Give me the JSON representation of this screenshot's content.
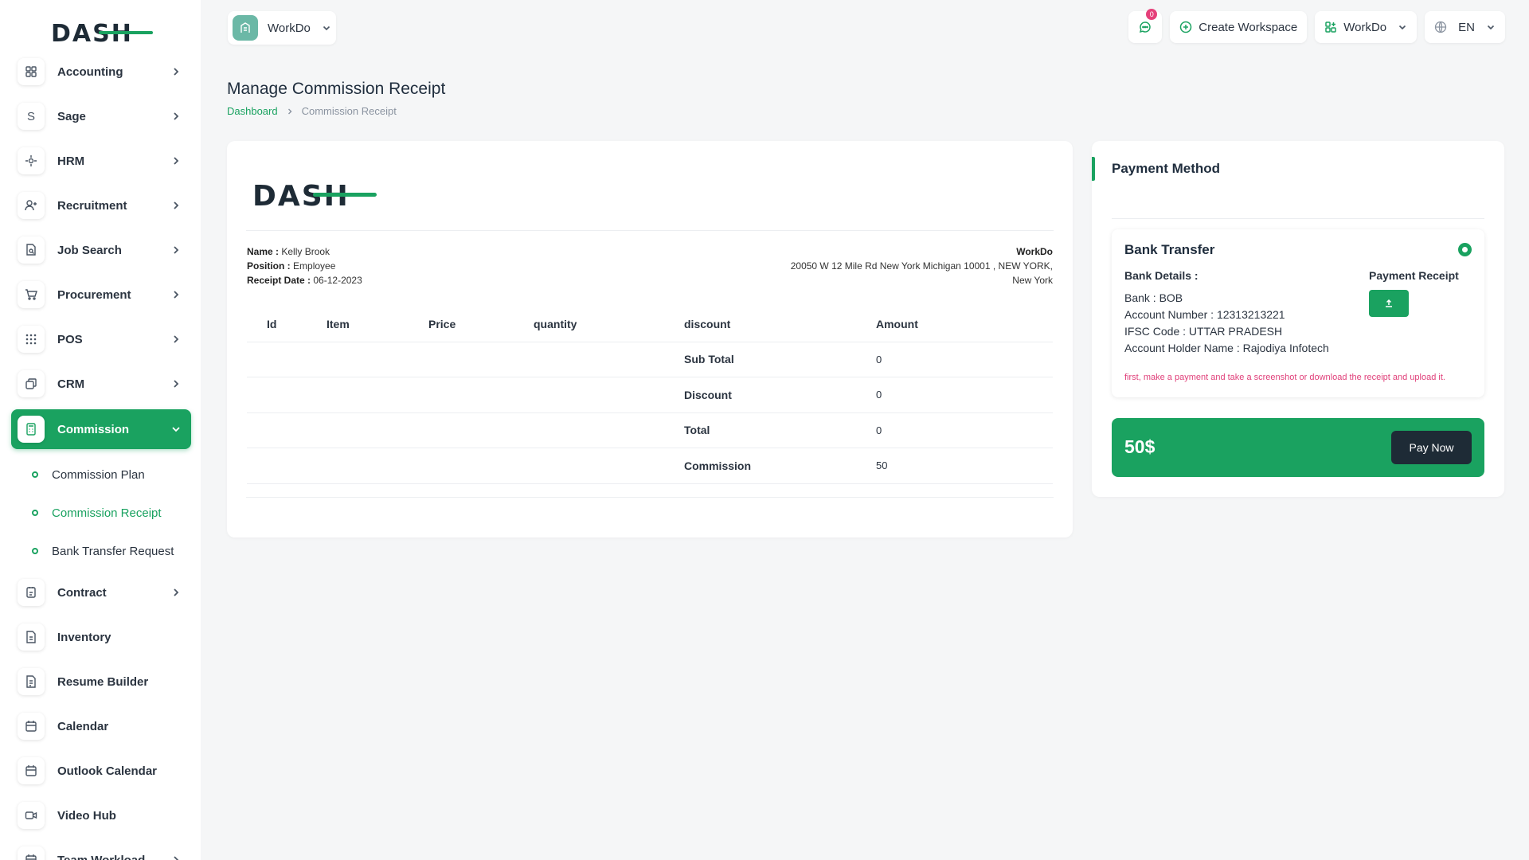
{
  "brand": {
    "logo_text": "DASH",
    "accent_color": "#1aa260",
    "dark_color": "#1e2b36"
  },
  "sidebar": {
    "items": [
      {
        "label": "Accounting",
        "icon": "grid-icon",
        "has_chevron": true
      },
      {
        "label": "Sage",
        "icon": "s-letter-icon",
        "has_chevron": true
      },
      {
        "label": "HRM",
        "icon": "hrm-icon",
        "has_chevron": true
      },
      {
        "label": "Recruitment",
        "icon": "user-plus-icon",
        "has_chevron": true
      },
      {
        "label": "Job Search",
        "icon": "file-search-icon",
        "has_chevron": true
      },
      {
        "label": "Procurement",
        "icon": "cart-icon",
        "has_chevron": true
      },
      {
        "label": "POS",
        "icon": "dots-grid-icon",
        "has_chevron": true
      },
      {
        "label": "CRM",
        "icon": "layers-icon",
        "has_chevron": true
      },
      {
        "label": "Commission",
        "icon": "calculator-icon",
        "has_chevron": true,
        "active": true
      },
      {
        "label": "Contract",
        "icon": "contract-icon",
        "has_chevron": true
      },
      {
        "label": "Inventory",
        "icon": "document-icon",
        "has_chevron": false
      },
      {
        "label": "Resume Builder",
        "icon": "document-icon",
        "has_chevron": false
      },
      {
        "label": "Calendar",
        "icon": "calendar-icon",
        "has_chevron": false
      },
      {
        "label": "Outlook Calendar",
        "icon": "calendar-icon",
        "has_chevron": false
      },
      {
        "label": "Video Hub",
        "icon": "video-icon",
        "has_chevron": false
      },
      {
        "label": "Team Workload",
        "icon": "calendar-icon",
        "has_chevron": true
      }
    ],
    "commission_sub": [
      {
        "label": "Commission Plan"
      },
      {
        "label": "Commission Receipt",
        "active": true
      },
      {
        "label": "Bank Transfer Request"
      }
    ]
  },
  "topbar": {
    "workspace_name": "WorkDo",
    "notification_count": "0",
    "create_workspace": "Create Workspace",
    "company": "WorkDo",
    "language": "EN"
  },
  "header": {
    "title": "Manage Commission Receipt",
    "breadcrumb": {
      "home": "Dashboard",
      "current": "Commission Receipt"
    }
  },
  "receipt": {
    "name_label": "Name :",
    "name": "Kelly Brook",
    "position_label": "Position :",
    "position": "Employee",
    "date_label": "Receipt Date :",
    "date": "06-12-2023",
    "company": "WorkDo",
    "address_line1": "20050 W 12 Mile Rd New York Michigan 10001 , NEW YORK,",
    "address_line2": "New York",
    "columns": [
      "Id",
      "Item",
      "Price",
      "quantity",
      "discount",
      "Amount"
    ],
    "summary": [
      {
        "label": "Sub Total",
        "value": "0"
      },
      {
        "label": "Discount",
        "value": "0"
      },
      {
        "label": "Total",
        "value": "0"
      },
      {
        "label": "Commission",
        "value": "50"
      }
    ]
  },
  "payment": {
    "title": "Payment Method",
    "method": "Bank Transfer",
    "bank_details_label": "Bank Details :",
    "bank": "Bank : BOB",
    "account_number": "Account Number : 12313213221",
    "ifsc": "IFSC Code : UTTAR PRADESH",
    "holder": "Account Holder Name : Rajodiya Infotech",
    "receipt_label": "Payment Receipt",
    "note": "first, make a payment and take a screenshot or download the receipt and upload it.",
    "amount": "50$",
    "pay_now": "Pay Now"
  }
}
